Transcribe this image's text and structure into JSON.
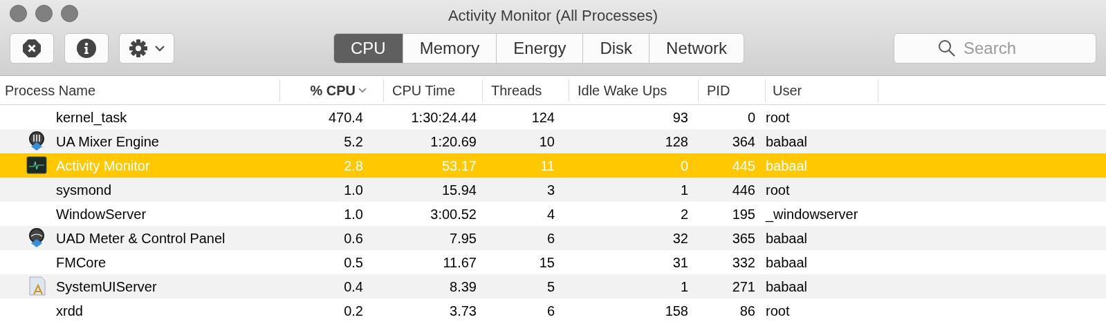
{
  "window": {
    "title": "Activity Monitor (All Processes)"
  },
  "tabs": [
    {
      "label": "CPU",
      "selected": true
    },
    {
      "label": "Memory",
      "selected": false
    },
    {
      "label": "Energy",
      "selected": false
    },
    {
      "label": "Disk",
      "selected": false
    },
    {
      "label": "Network",
      "selected": false
    }
  ],
  "search": {
    "placeholder": "Search"
  },
  "table": {
    "columns": [
      {
        "label": "Process Name",
        "sorted": false
      },
      {
        "label": "% CPU",
        "sorted": true
      },
      {
        "label": "CPU Time",
        "sorted": false
      },
      {
        "label": "Threads",
        "sorted": false
      },
      {
        "label": "Idle Wake Ups",
        "sorted": false
      },
      {
        "label": "PID",
        "sorted": false
      },
      {
        "label": "User",
        "sorted": false
      }
    ],
    "rows": [
      {
        "kind": "none",
        "selected": false,
        "cells": [
          "kernel_task",
          "470.4",
          "1:30:24.44",
          "124",
          "93",
          "0",
          "root"
        ]
      },
      {
        "kind": "mixer",
        "selected": false,
        "cells": [
          "UA Mixer Engine",
          "5.2",
          "1:20.69",
          "10",
          "128",
          "364",
          "babaal"
        ]
      },
      {
        "kind": "monitor",
        "selected": true,
        "cells": [
          "Activity Monitor",
          "2.8",
          "53.17",
          "11",
          "0",
          "445",
          "babaal"
        ]
      },
      {
        "kind": "none",
        "selected": false,
        "cells": [
          "sysmond",
          "1.0",
          "15.94",
          "3",
          "1",
          "446",
          "root"
        ]
      },
      {
        "kind": "none",
        "selected": false,
        "cells": [
          "WindowServer",
          "1.0",
          "3:00.52",
          "4",
          "2",
          "195",
          "_windowserver"
        ]
      },
      {
        "kind": "meter",
        "selected": false,
        "cells": [
          "UAD Meter & Control Panel",
          "0.6",
          "7.95",
          "6",
          "32",
          "365",
          "babaal"
        ]
      },
      {
        "kind": "none",
        "selected": false,
        "cells": [
          "FMCore",
          "0.5",
          "11.67",
          "15",
          "31",
          "332",
          "babaal"
        ]
      },
      {
        "kind": "app",
        "selected": false,
        "cells": [
          "SystemUIServer",
          "0.4",
          "8.39",
          "5",
          "1",
          "271",
          "babaal"
        ]
      },
      {
        "kind": "none",
        "selected": false,
        "cells": [
          "xrdd",
          "0.2",
          "3.73",
          "6",
          "158",
          "86",
          "root"
        ]
      }
    ]
  }
}
